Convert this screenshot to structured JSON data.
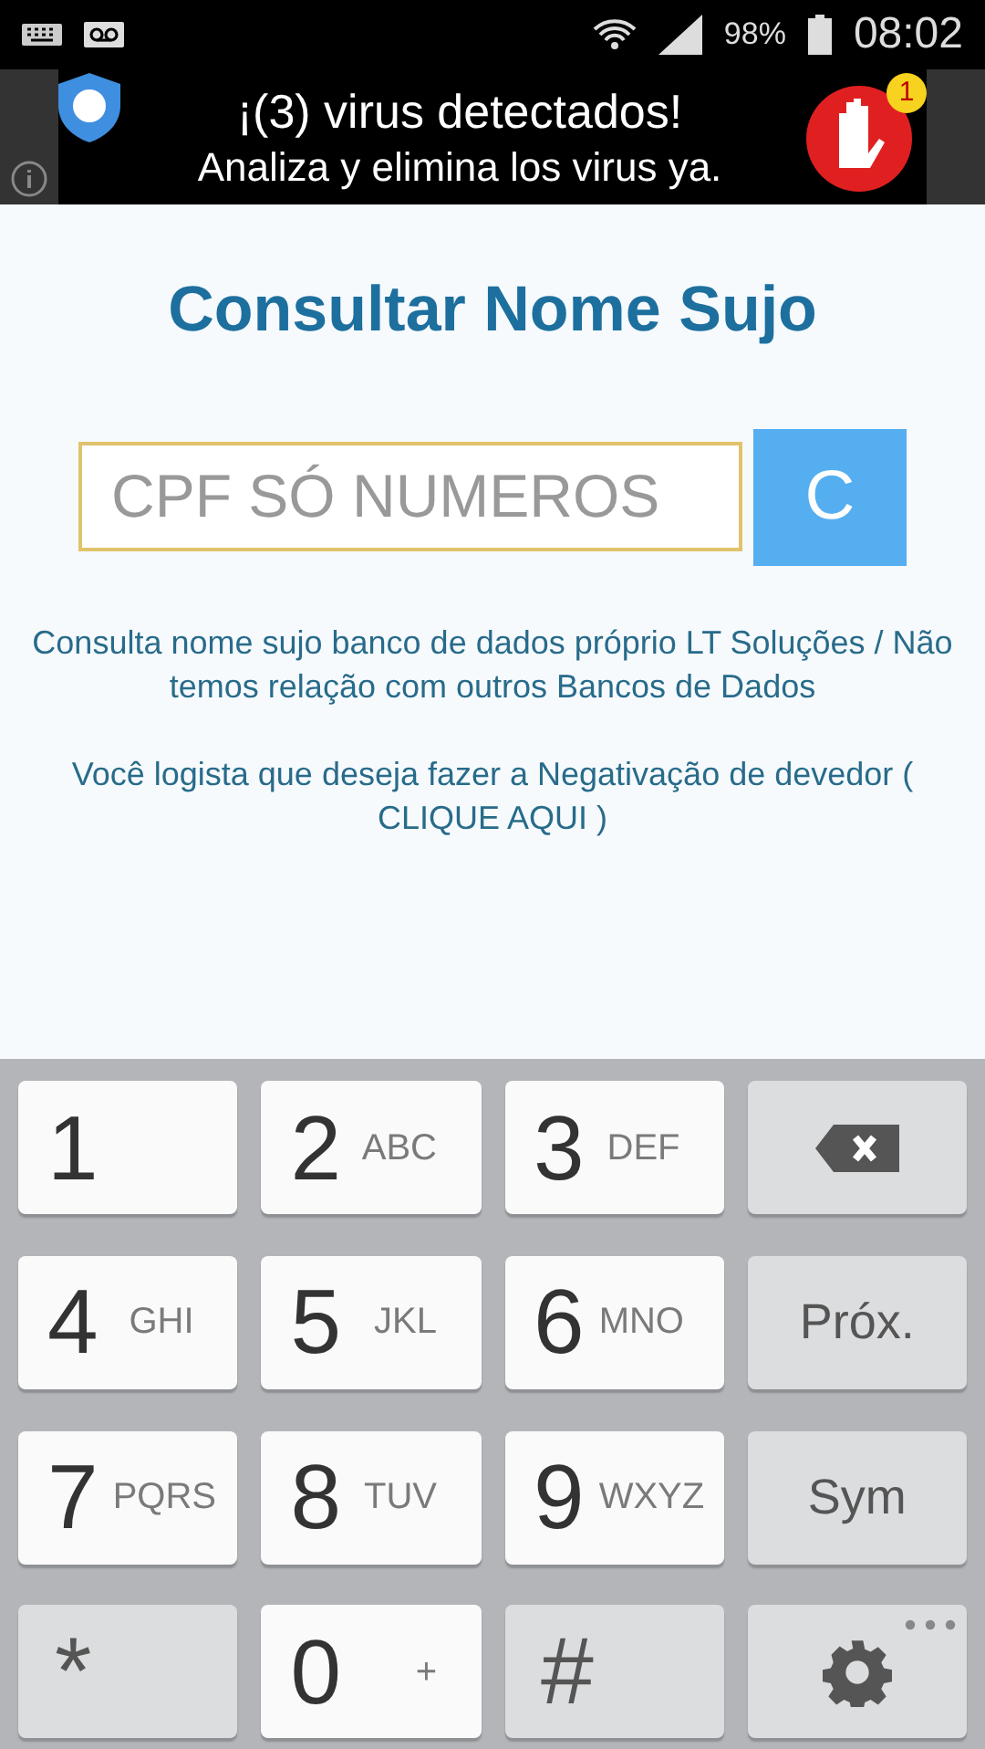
{
  "status_bar": {
    "battery": "98%",
    "time": "08:02"
  },
  "ad": {
    "headline": "¡(3) virus detectados!",
    "subline": "Analiza y elimina los virus ya.",
    "badge": "1"
  },
  "title": "Consultar Nome Sujo",
  "search": {
    "placeholder": "CPF SÓ NUMEROS",
    "button": "C"
  },
  "info": [
    "Consulta nome sujo banco de dados próprio LT Soluções / Não temos relação com outros Bancos de Dados",
    "Você logista que deseja fazer a Negativação de devedor ( CLIQUE AQUI )"
  ],
  "keyboard": [
    {
      "kind": "digit",
      "label": "1"
    },
    {
      "kind": "digit",
      "label": "2",
      "letters": "ABC"
    },
    {
      "kind": "digit",
      "label": "3",
      "letters": "DEF"
    },
    {
      "kind": "backspace"
    },
    {
      "kind": "digit",
      "label": "4",
      "letters": "GHI"
    },
    {
      "kind": "digit",
      "label": "5",
      "letters": "JKL"
    },
    {
      "kind": "digit",
      "label": "6",
      "letters": "MNO"
    },
    {
      "kind": "function",
      "label": "Próx."
    },
    {
      "kind": "digit",
      "label": "7",
      "letters": "PQRS"
    },
    {
      "kind": "digit",
      "label": "8",
      "letters": "TUV"
    },
    {
      "kind": "digit",
      "label": "9",
      "letters": "WXYZ"
    },
    {
      "kind": "function",
      "label": "Sym"
    },
    {
      "kind": "symbol",
      "label": "*"
    },
    {
      "kind": "digit",
      "label": "0",
      "letters": "+"
    },
    {
      "kind": "symbol",
      "label": "#"
    },
    {
      "kind": "settings"
    }
  ]
}
